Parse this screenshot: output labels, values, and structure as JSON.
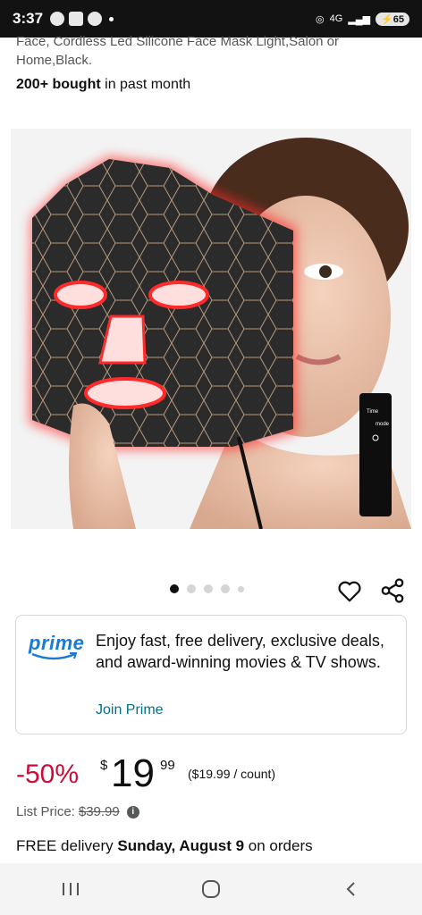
{
  "status_bar": {
    "time": "3:37",
    "network": "4G",
    "battery": "65"
  },
  "product": {
    "title_fragment": "Face, Cordless Led Silicone Face Mask Light,Salon or Home,Black.",
    "bought_strong": "200+ bought",
    "bought_rest": " in past month"
  },
  "gallery": {
    "count": 5,
    "active_index": 0
  },
  "prime": {
    "logo": "prime",
    "message": "Enjoy fast, free delivery, exclusive deals, and award-winning movies & TV shows.",
    "join_label": "Join Prime",
    "brand_color": "#1a7bd6"
  },
  "pricing": {
    "discount": "-50%",
    "currency": "$",
    "whole": "19",
    "fraction": "99",
    "unit_price": "($19.99 / count)",
    "list_label": "List Price:",
    "list_price": "$39.99",
    "discount_color": "#cc0c39"
  },
  "delivery": {
    "prefix": "FREE delivery ",
    "date": "Sunday, August 9",
    "suffix": " on orders"
  },
  "device_labels": {
    "time": "Time",
    "mode": "mode"
  },
  "nav": {
    "recent": "recent-apps",
    "home": "home",
    "back": "back"
  }
}
